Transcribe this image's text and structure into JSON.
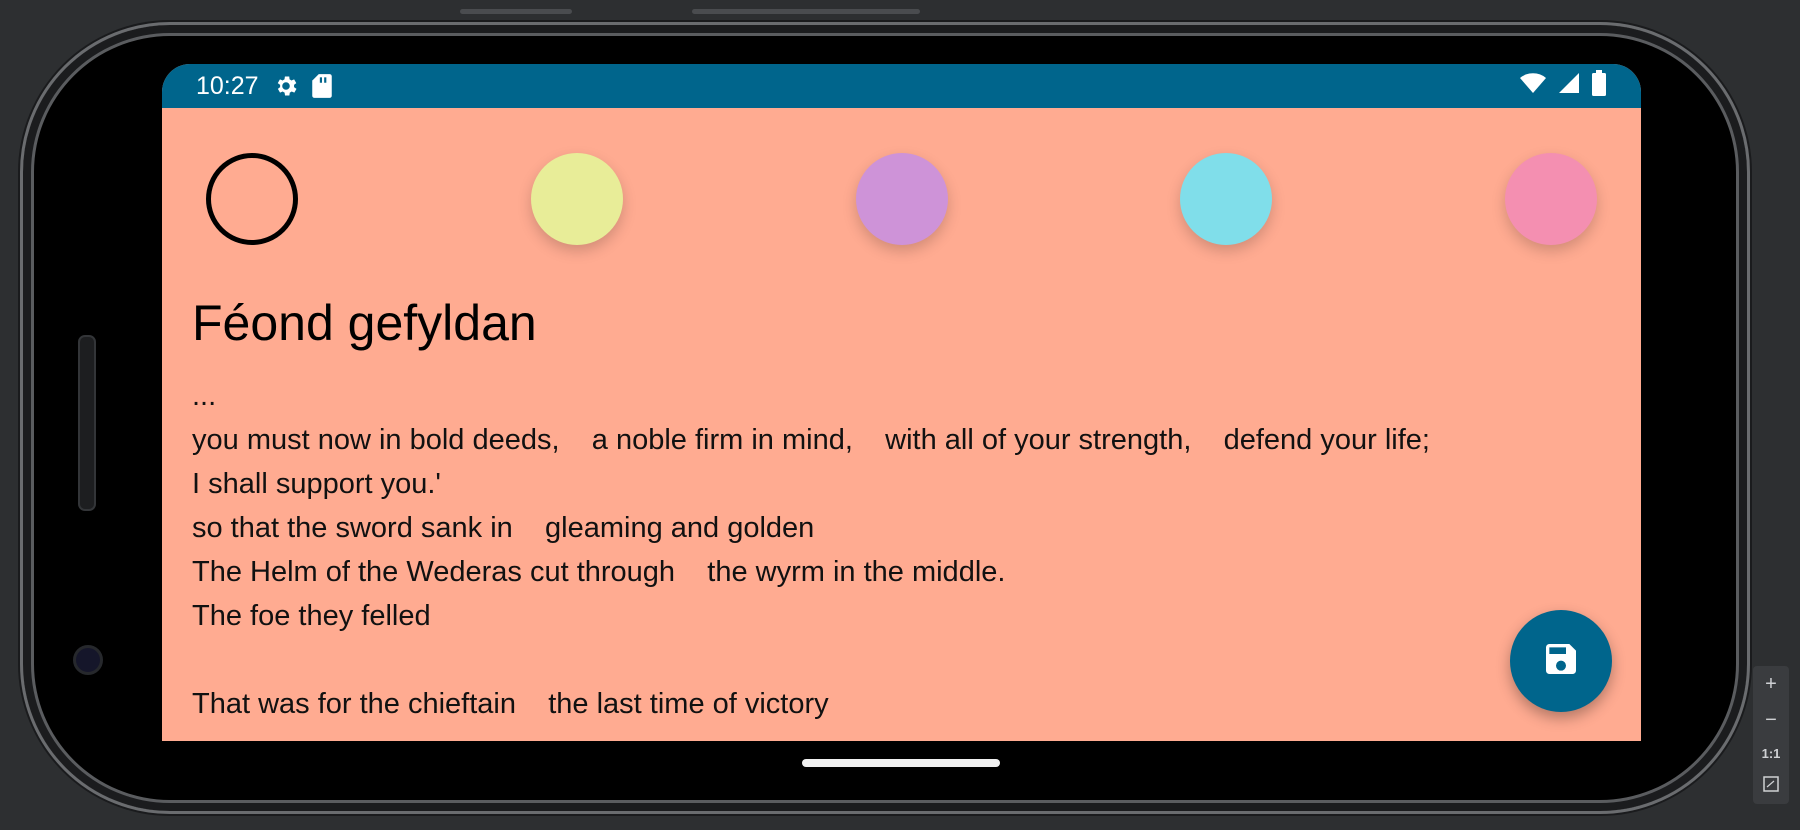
{
  "status_bar": {
    "time": "10:27",
    "icons_left": [
      "settings-icon",
      "sd-card-icon"
    ],
    "icons_right": [
      "wifi-icon",
      "signal-icon",
      "battery-icon"
    ]
  },
  "colors": {
    "options": [
      "#ffab91",
      "#e8ed98",
      "#ce93d8",
      "#80deea",
      "#f48fb1"
    ],
    "selected": "#ffab91"
  },
  "note": {
    "title": "Féond gefyldan",
    "lines": [
      "...",
      "you must now in bold deeds,    a noble firm in mind,    with all of your strength,    defend your life;",
      "I shall support you.'",
      "so that the sword sank in    gleaming and golden",
      "The Helm of the Wederas cut through    the wyrm in the middle.",
      "The foe they felled",
      "",
      "That was for the chieftain    the last time of victory"
    ]
  },
  "fab": {
    "icon": "save-icon"
  },
  "zoom_controls": {
    "zoom_in": "+",
    "zoom_out": "−",
    "actual_size": "1:1"
  },
  "theme": {
    "accent": "#00658c",
    "background": "#ffab91"
  }
}
